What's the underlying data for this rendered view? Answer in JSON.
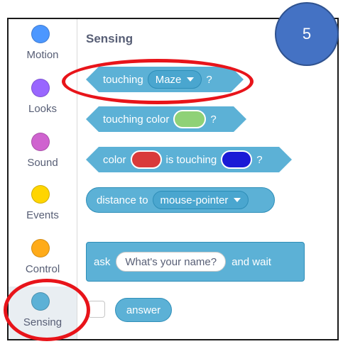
{
  "colors": {
    "sensing": "#5cb1d6",
    "sensing_border": "#2e8eb8",
    "motion": "#4c97ff",
    "looks": "#9966ff",
    "sound": "#cf63cf",
    "events": "#ffd500",
    "control": "#ffab19",
    "highlight": "#e8141a",
    "badge": "#4472c4"
  },
  "badge": {
    "number": "5"
  },
  "categories": [
    {
      "label": "Motion",
      "color": "#4c97ff",
      "selected": false
    },
    {
      "label": "Looks",
      "color": "#9966ff",
      "selected": false
    },
    {
      "label": "Sound",
      "color": "#cf63cf",
      "selected": false
    },
    {
      "label": "Events",
      "color": "#ffd500",
      "selected": false
    },
    {
      "label": "Control",
      "color": "#ffab19",
      "selected": false
    },
    {
      "label": "Sensing",
      "color": "#5cb1d6",
      "selected": true
    }
  ],
  "palette": {
    "title": "Sensing",
    "blocks": {
      "touching": {
        "text": "touching",
        "dropdown": "Maze",
        "end": "?"
      },
      "touching_color": {
        "text": "touching color",
        "swatch": "#8fd177",
        "end": "?"
      },
      "color_touching": {
        "text1": "color",
        "swatch1": "#d93a3a",
        "text2": "is touching",
        "swatch2": "#1a1ad6",
        "end": "?"
      },
      "distance": {
        "text": "distance to",
        "dropdown": "mouse-pointer"
      },
      "ask": {
        "text1": "ask",
        "input": "What's your name?",
        "text2": "and wait"
      },
      "answer": {
        "text": "answer"
      }
    }
  }
}
